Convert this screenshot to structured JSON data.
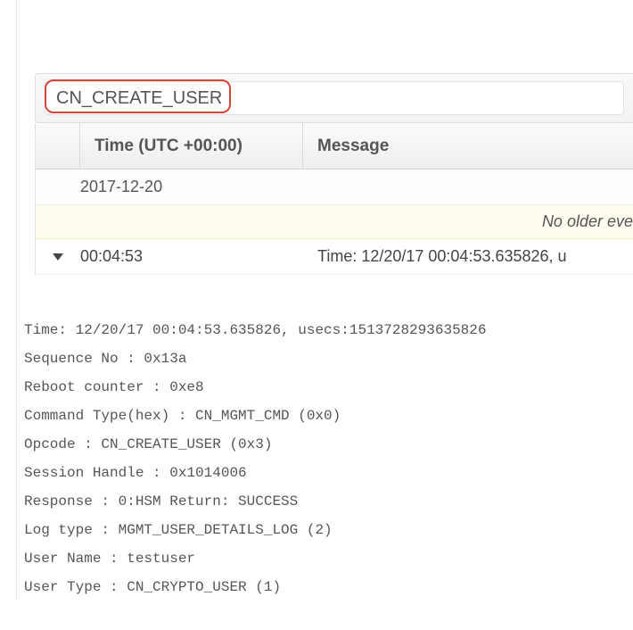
{
  "search": {
    "value": "CN_CREATE_USER"
  },
  "columns": {
    "time": "Time (UTC +00:00)",
    "message": "Message"
  },
  "date_group": "2017-12-20",
  "notice": "No older eve",
  "event": {
    "time": "00:04:53",
    "message": "Time: 12/20/17 00:04:53.635826, u"
  },
  "details": {
    "l0": "Time: 12/20/17 00:04:53.635826, usecs:1513728293635826",
    "l1": "Sequence No : 0x13a",
    "l2": "Reboot counter : 0xe8",
    "l3": "Command Type(hex) : CN_MGMT_CMD (0x0)",
    "l4": "Opcode : CN_CREATE_USER (0x3)",
    "l5": "Session Handle : 0x1014006",
    "l6": "Response : 0:HSM Return: SUCCESS",
    "l7": "Log type : MGMT_USER_DETAILS_LOG (2)",
    "l8": "User Name : testuser",
    "l9": "User Type : CN_CRYPTO_USER (1)"
  }
}
